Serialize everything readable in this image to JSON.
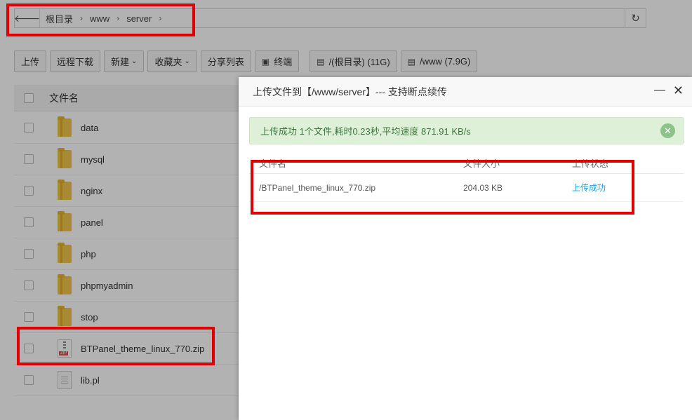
{
  "pathbar": {
    "back_icon": "arrow-left-icon",
    "crumbs": [
      "根目录",
      "www",
      "server"
    ],
    "refresh_icon": "refresh-icon"
  },
  "toolbar": {
    "upload": "上传",
    "remote_download": "远程下载",
    "new": "新建",
    "favorites": "收藏夹",
    "share_list": "分享列表",
    "terminal": "终端",
    "disk_root": "/(根目录) (11G)",
    "disk_www": "/www (7.9G)"
  },
  "table": {
    "header_name": "文件名",
    "files": [
      {
        "name": "data",
        "type": "folder"
      },
      {
        "name": "mysql",
        "type": "folder"
      },
      {
        "name": "nginx",
        "type": "folder"
      },
      {
        "name": "panel",
        "type": "folder"
      },
      {
        "name": "php",
        "type": "folder"
      },
      {
        "name": "phpmyadmin",
        "type": "folder"
      },
      {
        "name": "stop",
        "type": "folder"
      },
      {
        "name": "BTPanel_theme_linux_770.zip",
        "type": "zip"
      },
      {
        "name": "lib.pl",
        "type": "text"
      }
    ]
  },
  "dialog": {
    "title": "上传文件到【/www/server】--- 支持断点续传",
    "minimize_icon": "minimize-icon",
    "close_icon": "close-icon",
    "alert": "上传成功 1个文件,耗时0.23秒,平均速度 871.91 KB/s",
    "columns": [
      "文件名",
      "文件大小",
      "上传状态"
    ],
    "uploads": [
      {
        "name": "/BTPanel_theme_linux_770.zip",
        "size": "204.03 KB",
        "status": "上传成功"
      }
    ]
  },
  "colors": {
    "highlight": "#e00000",
    "success_bg": "#dff0d8",
    "success_text": "#3c763d",
    "status_link": "#20a0e0"
  }
}
